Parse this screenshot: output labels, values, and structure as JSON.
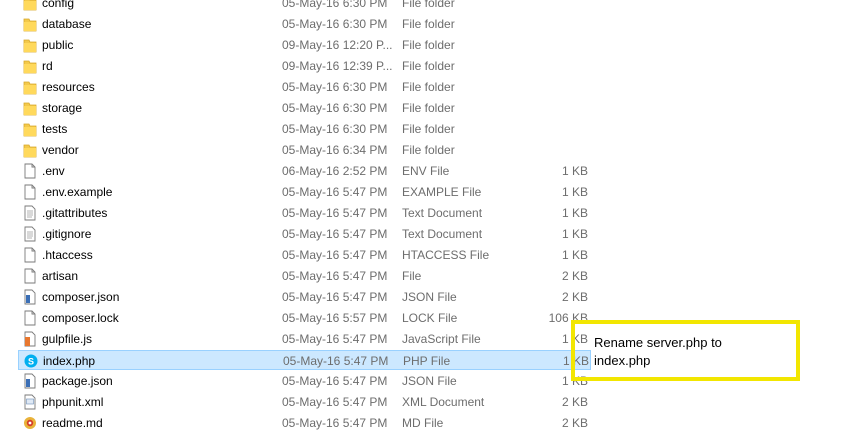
{
  "files": [
    {
      "name": "config",
      "date": "05-May-16 6:30 PM",
      "type": "File folder",
      "size": "",
      "icon": "folder-icon"
    },
    {
      "name": "database",
      "date": "05-May-16 6:30 PM",
      "type": "File folder",
      "size": "",
      "icon": "folder-icon"
    },
    {
      "name": "public",
      "date": "09-May-16 12:20 P...",
      "type": "File folder",
      "size": "",
      "icon": "folder-icon"
    },
    {
      "name": "rd",
      "date": "09-May-16 12:39 P...",
      "type": "File folder",
      "size": "",
      "icon": "folder-icon"
    },
    {
      "name": "resources",
      "date": "05-May-16 6:30 PM",
      "type": "File folder",
      "size": "",
      "icon": "folder-icon"
    },
    {
      "name": "storage",
      "date": "05-May-16 6:30 PM",
      "type": "File folder",
      "size": "",
      "icon": "folder-icon"
    },
    {
      "name": "tests",
      "date": "05-May-16 6:30 PM",
      "type": "File folder",
      "size": "",
      "icon": "folder-icon"
    },
    {
      "name": "vendor",
      "date": "05-May-16 6:34 PM",
      "type": "File folder",
      "size": "",
      "icon": "folder-icon"
    },
    {
      "name": ".env",
      "date": "06-May-16 2:52 PM",
      "type": "ENV File",
      "size": "1 KB",
      "icon": "file-icon"
    },
    {
      "name": ".env.example",
      "date": "05-May-16 5:47 PM",
      "type": "EXAMPLE File",
      "size": "1 KB",
      "icon": "file-icon"
    },
    {
      "name": ".gitattributes",
      "date": "05-May-16 5:47 PM",
      "type": "Text Document",
      "size": "1 KB",
      "icon": "text-document-icon"
    },
    {
      "name": ".gitignore",
      "date": "05-May-16 5:47 PM",
      "type": "Text Document",
      "size": "1 KB",
      "icon": "text-document-icon"
    },
    {
      "name": ".htaccess",
      "date": "05-May-16 5:47 PM",
      "type": "HTACCESS File",
      "size": "1 KB",
      "icon": "file-icon"
    },
    {
      "name": "artisan",
      "date": "05-May-16 5:47 PM",
      "type": "File",
      "size": "2 KB",
      "icon": "file-icon"
    },
    {
      "name": "composer.json",
      "date": "05-May-16 5:47 PM",
      "type": "JSON File",
      "size": "2 KB",
      "icon": "json-file-icon"
    },
    {
      "name": "composer.lock",
      "date": "05-May-16 5:57 PM",
      "type": "LOCK File",
      "size": "106 KB",
      "icon": "file-icon"
    },
    {
      "name": "gulpfile.js",
      "date": "05-May-16 5:47 PM",
      "type": "JavaScript File",
      "size": "1 KB",
      "icon": "javascript-file-icon"
    },
    {
      "name": "index.php",
      "date": "05-May-16 5:47 PM",
      "type": "PHP File",
      "size": "1 KB",
      "icon": "skype-php-icon",
      "selected": true
    },
    {
      "name": "package.json",
      "date": "05-May-16 5:47 PM",
      "type": "JSON File",
      "size": "1 KB",
      "icon": "json-file-icon"
    },
    {
      "name": "phpunit.xml",
      "date": "05-May-16 5:47 PM",
      "type": "XML Document",
      "size": "2 KB",
      "icon": "xml-document-icon"
    },
    {
      "name": "readme.md",
      "date": "05-May-16 5:47 PM",
      "type": "MD File",
      "size": "2 KB",
      "icon": "md-file-icon"
    }
  ],
  "annotation": {
    "text": "Rename server.php to index.php",
    "border_color": "#f2e600"
  },
  "colors": {
    "selection_bg": "#cce8ff",
    "selection_border": "#99d1ff",
    "folder": "#f3c94b"
  }
}
